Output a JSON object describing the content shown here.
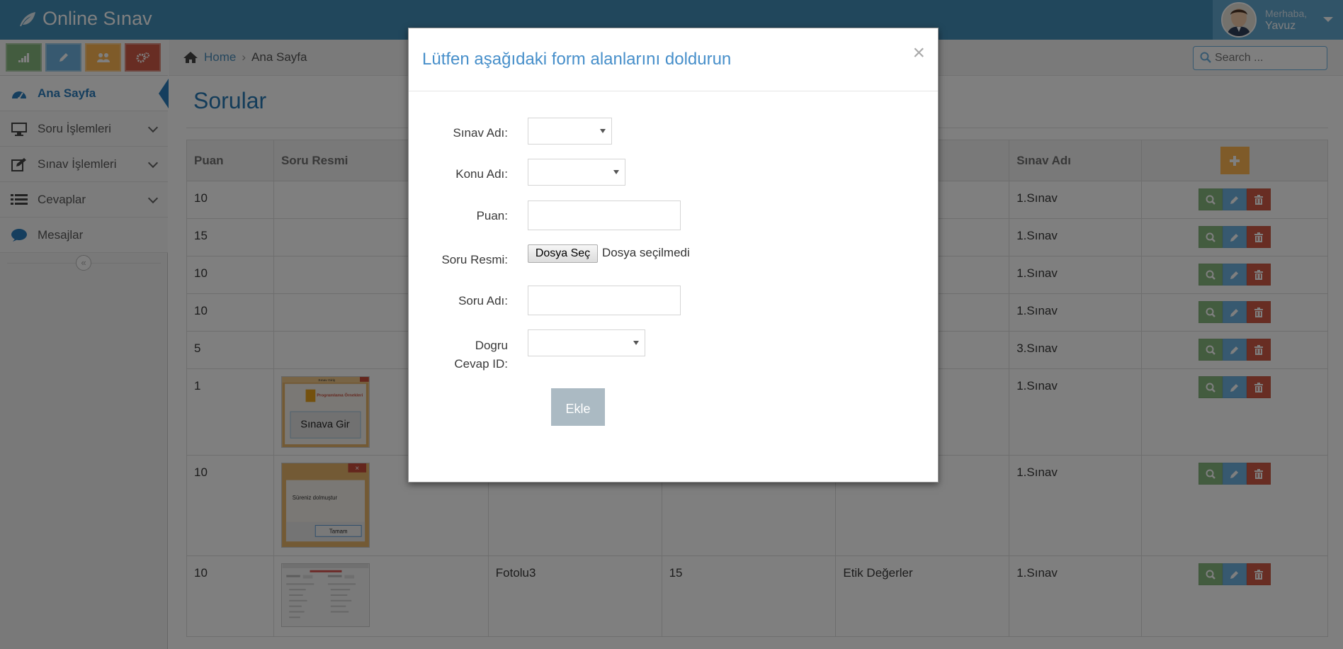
{
  "app": {
    "title": "Online Sınav"
  },
  "user": {
    "greeting": "Merhaba,",
    "name": "Yavuz"
  },
  "sidebar": {
    "shortcuts": [
      {
        "icon": "signal-icon",
        "color": "#87b87f"
      },
      {
        "icon": "pencil-icon",
        "color": "#6fb3e0"
      },
      {
        "icon": "group-icon",
        "color": "#ffb752"
      },
      {
        "icon": "cogs-icon",
        "color": "#d15b47"
      }
    ],
    "items": [
      {
        "label": "Ana Sayfa",
        "icon": "dashboard-icon",
        "active": true
      },
      {
        "label": "Soru İşlemleri",
        "icon": "desktop-icon"
      },
      {
        "label": "Sınav İşlemleri",
        "icon": "edit-icon"
      },
      {
        "label": "Cevaplar",
        "icon": "list-icon"
      },
      {
        "label": "Mesajlar",
        "icon": "comment-icon"
      }
    ]
  },
  "breadcrumb": {
    "home": "Home",
    "current": "Ana Sayfa"
  },
  "search": {
    "placeholder": "Search ..."
  },
  "page": {
    "title": "Sorular"
  },
  "table": {
    "columns": [
      "Puan",
      "Soru Resmi",
      "",
      "",
      "",
      "Sınav Adı"
    ],
    "rows": [
      {
        "puan": "10",
        "image": "",
        "soru": "",
        "sure": "",
        "konu": "",
        "sinav": "1.Sınav"
      },
      {
        "puan": "15",
        "image": "",
        "soru": "",
        "sure": "",
        "konu": "",
        "sinav": "1.Sınav"
      },
      {
        "puan": "10",
        "image": "",
        "soru": "",
        "sure": "",
        "konu": "",
        "sinav": "1.Sınav"
      },
      {
        "puan": "10",
        "image": "",
        "soru": "",
        "sure": "",
        "konu": "",
        "sinav": "1.Sınav"
      },
      {
        "puan": "5",
        "image": "",
        "soru": "",
        "sure": "",
        "konu": "",
        "sinav": "3.Sınav"
      },
      {
        "puan": "1",
        "image": "sinava-gir",
        "soru": "",
        "sure": "",
        "konu": "",
        "sinav": "1.Sınav"
      },
      {
        "puan": "10",
        "image": "sureniz-dolmustur",
        "soru": "",
        "sure": "",
        "konu": "",
        "sinav": "1.Sınav"
      },
      {
        "puan": "10",
        "image": "form-screenshot",
        "soru": "Fotolu3",
        "sure": "15",
        "konu": "Etik Değerler",
        "sinav": "1.Sınav"
      }
    ],
    "thumbnails": {
      "sinava_gir": {
        "title": "Sınav Giriş",
        "brand": "Programlama Örnekleri",
        "button": "Sınava Gir"
      },
      "sureniz": {
        "message": "Süreniz dolmuştur",
        "button": "Tamam"
      }
    }
  },
  "modal": {
    "title": "Lütfen aşağıdaki form alanlarını doldurun",
    "close": "×",
    "fields": {
      "sinav_adi": "Sınav Adı:",
      "konu_adi": "Konu Adı:",
      "puan": "Puan:",
      "soru_resmi": "Soru Resmi:",
      "soru_adi": "Soru Adı:",
      "dogru_cevap_1": "Dogru",
      "dogru_cevap_2": "Cevap ID:"
    },
    "file_button": "Dosya Seç",
    "file_status": "Dosya seçilmedi",
    "submit": "Ekle"
  },
  "colors": {
    "navbar": "#438eb9",
    "accent": "#2679b5",
    "success": "#87b87f",
    "info": "#6fb3e0",
    "danger": "#d15b47",
    "warning": "#ffb752"
  }
}
